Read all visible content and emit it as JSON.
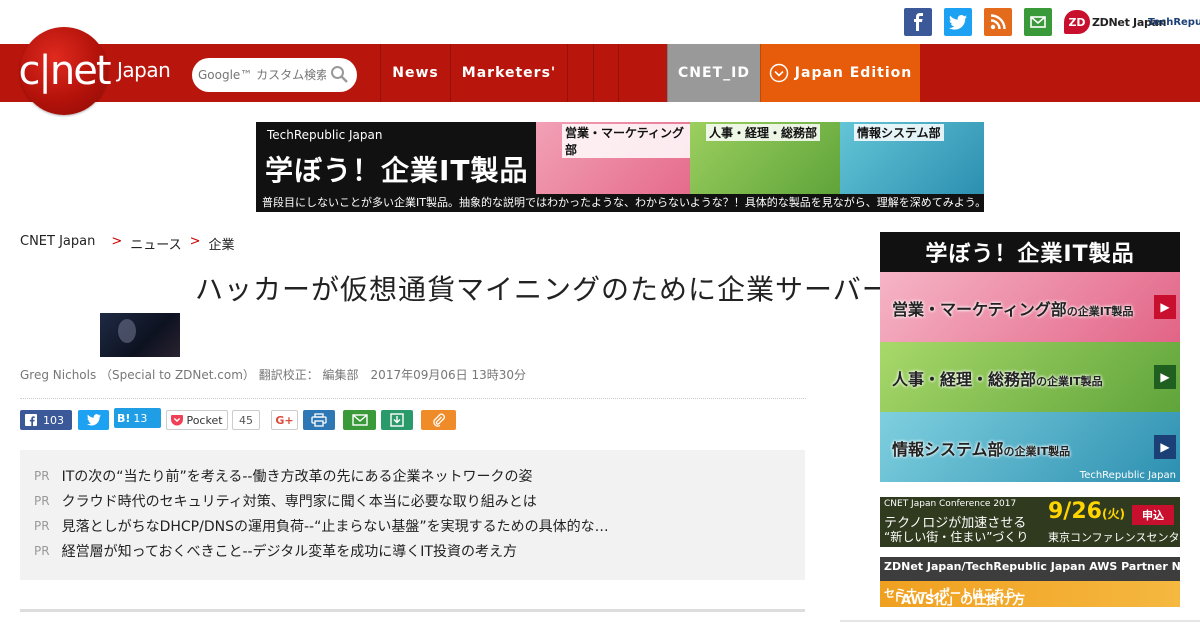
{
  "social": {
    "icons": [
      "facebook-icon",
      "twitter-icon",
      "rss-icon",
      "mail-icon"
    ],
    "zdnet_logo": "ZDNet Japan",
    "techrepublic_logo": "TechRepublic"
  },
  "header": {
    "logo": "c|net",
    "logo_sub": "Japan",
    "search_placeholder": "Google™ カスタム検索",
    "nav": [
      {
        "label": "News"
      },
      {
        "label": "Marketers'"
      },
      {
        "label": ""
      },
      {
        "label": ""
      },
      {
        "label": ""
      },
      {
        "label": "CNET_ID"
      },
      {
        "label": "Japan Edition"
      }
    ],
    "colors": {
      "bar": "#b8150c",
      "cnet_id": "#999999",
      "edition": "#e65c0a"
    }
  },
  "banner": {
    "small": "TechRepublic Japan",
    "title": "学ぼう！企業IT製品",
    "segments": [
      "営業・マーケティング部",
      "人事・経理・総務部",
      "情報システム部"
    ],
    "footer": "普段目にしないことが多い企業IT製品。抽象的な説明ではわかったような、わからないような？！具体的な製品を見ながら、理解を深めてみよう。"
  },
  "breadcrumb": {
    "items": [
      "CNET Japan",
      "ニュース",
      "企業"
    ],
    "separator": ">"
  },
  "article": {
    "headline": "ハッカーが仮想通貨マイニングのために企業サーバーを狙う",
    "byline": "Greg Nichols （Special to ZDNet.com） 翻訳校正： 編集部　2017年09月06日 13時30分"
  },
  "share": {
    "facebook_count": "103",
    "hatena_label": "B!",
    "hatena_count": "13",
    "pocket_label": "Pocket",
    "pocket_count": "45",
    "gplus_label": "G+",
    "icons": [
      "print-icon",
      "mail-share-icon",
      "save-icon",
      "clip-icon"
    ]
  },
  "pr": {
    "tag": "PR",
    "items": [
      "ITの次の“当たり前”を考える--働き方改革の先にある企業ネットワークの姿",
      "クラウド時代のセキュリティ対策、専門家に聞く本当に必要な取り組みとは",
      "見落としがちなDHCP/DNSの運用負荷--“止まらない基盤”を実現するための具体的な…",
      "経営層が知っておくべきこと--デジタル変革を成功に導くIT投資の考え方"
    ]
  },
  "sidebar": {
    "ad1": {
      "title": "学ぼう！企業IT製品",
      "segments": [
        {
          "label": "営業・マーケティング部",
          "suffix": "の企業IT製品"
        },
        {
          "label": "人事・経理・総務部",
          "suffix": "の企業IT製品"
        },
        {
          "label": "情報システム部",
          "suffix": "の企業IT製品"
        }
      ],
      "footer": "TechRepublic Japan"
    },
    "ad2": {
      "small": "CNET Japan Conference 2017",
      "line1": "テクノロジが加速させる",
      "line2": "“新しい街・住まい”づくり",
      "date": "9/26",
      "weekday": "(火)",
      "button": "申込",
      "venue": "東京コンファレンスセンター"
    },
    "ad3": {
      "top": "ZDNet Japan/TechRepublic Japan  AWS Partner Network",
      "main": "「AWS化」の仕掛け方",
      "sub": "セミナーレポートはこちら"
    }
  }
}
